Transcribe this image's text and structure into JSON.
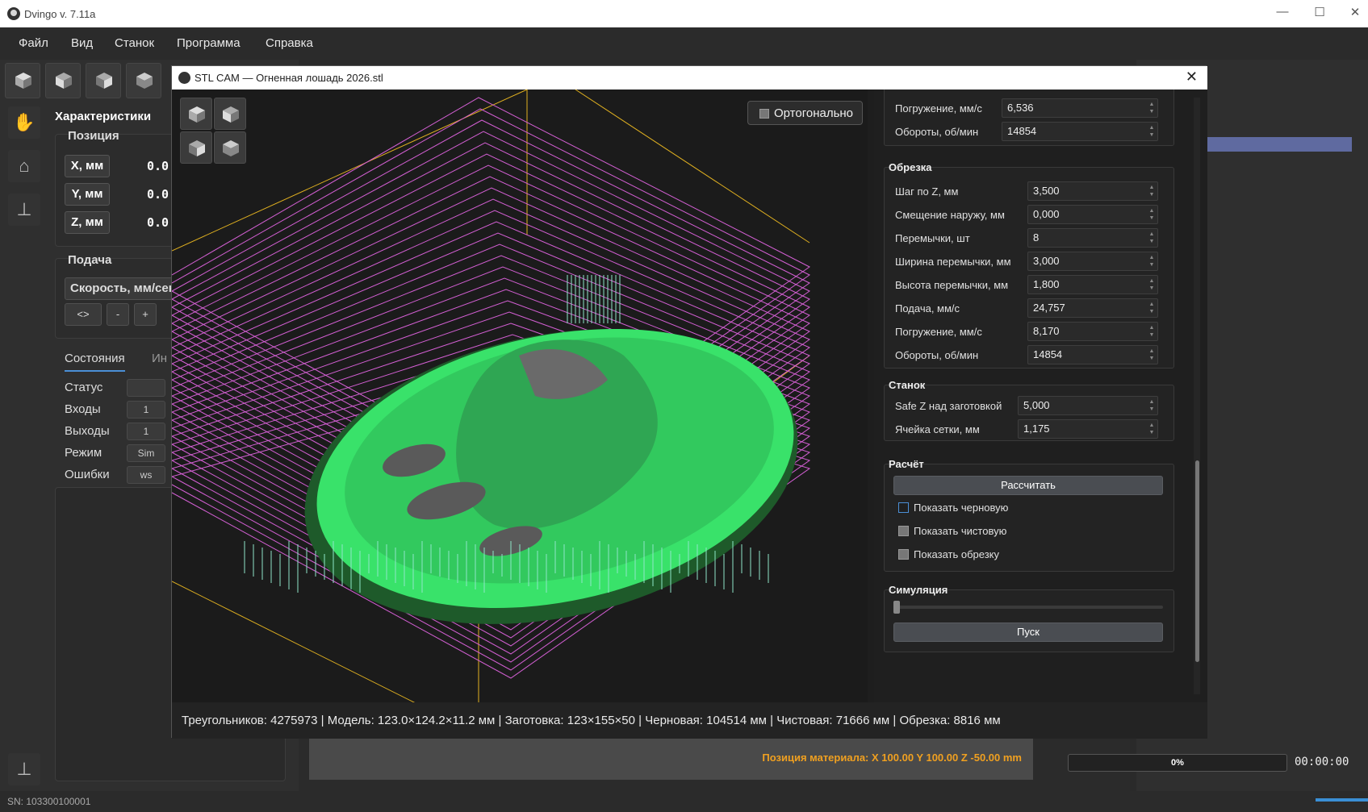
{
  "app": {
    "title": "Dvingo v. 7.11a"
  },
  "menu": [
    "Файл",
    "Вид",
    "Станок",
    "Программа",
    "Справка"
  ],
  "left": {
    "heading": "Характеристики",
    "position_group": "Позиция",
    "axes": [
      {
        "label": "X, мм",
        "value": "0.0"
      },
      {
        "label": "Y, мм",
        "value": "0.0"
      },
      {
        "label": "Z, мм",
        "value": "0.0"
      }
    ],
    "feed_group": "Подача",
    "feed_label": "Скорость, мм/сек",
    "feed_buttons": [
      "<>",
      "-",
      "+"
    ],
    "tabs": [
      "Состояния",
      "Ин"
    ],
    "states": [
      {
        "label": "Статус",
        "value": ""
      },
      {
        "label": "Входы",
        "value": "1"
      },
      {
        "label": "Выходы",
        "value": "1"
      },
      {
        "label": "Режим",
        "value": "Sim"
      },
      {
        "label": "Ошибки",
        "value": "ws"
      }
    ]
  },
  "dialog": {
    "title": "STL CAM — Огненная лошадь 2026.stl",
    "ortho_label": "Ортогонально",
    "top_fields": [
      {
        "label": "Погружение, мм/с",
        "value": "6,536"
      },
      {
        "label": "Обороты, об/мин",
        "value": "14854"
      }
    ],
    "trim": {
      "title": "Обрезка",
      "fields": [
        {
          "label": "Шаг по Z, мм",
          "value": "3,500"
        },
        {
          "label": "Смещение наружу, мм",
          "value": "0,000"
        },
        {
          "label": "Перемычки, шт",
          "value": "8"
        },
        {
          "label": "Ширина перемычки, мм",
          "value": "3,000"
        },
        {
          "label": "Высота перемычки, мм",
          "value": "1,800"
        },
        {
          "label": "Подача, мм/с",
          "value": "24,757"
        },
        {
          "label": "Погружение, мм/с",
          "value": "8,170"
        },
        {
          "label": "Обороты, об/мин",
          "value": "14854"
        }
      ]
    },
    "machine": {
      "title": "Станок",
      "fields": [
        {
          "label": "Safe Z над заготовкой",
          "value": "5,000"
        },
        {
          "label": "Ячейка сетки, мм",
          "value": "1,175"
        }
      ]
    },
    "calc": {
      "title": "Расчёт",
      "button": "Рассчитать",
      "checks": [
        {
          "label": "Показать черновую",
          "checked": false
        },
        {
          "label": "Показать чистовую",
          "checked": true
        },
        {
          "label": "Показать обрезку",
          "checked": true
        }
      ]
    },
    "sim": {
      "title": "Симуляция",
      "button": "Пуск"
    },
    "status": "Треугольников: 4275973 | Модель: 123.0×124.2×11.2 мм | Заготовка: 123×155×50 | Черновая: 104514 мм | Чистовая: 71666 мм | Обрезка: 8816 мм"
  },
  "bottom": {
    "material_position": "Позиция материала: X 100.00   Y 100.00   Z -50.00 mm",
    "progress": "0%",
    "progress_value": 0,
    "time": "00:00:00"
  },
  "statusbar": {
    "sn": "SN: 103300100001"
  },
  "colors": {
    "accent_orange": "#f0a020",
    "toolpath_green": "#39e26a",
    "grid_magenta": "#d35fd3",
    "axis_yellow": "#e0b020"
  }
}
